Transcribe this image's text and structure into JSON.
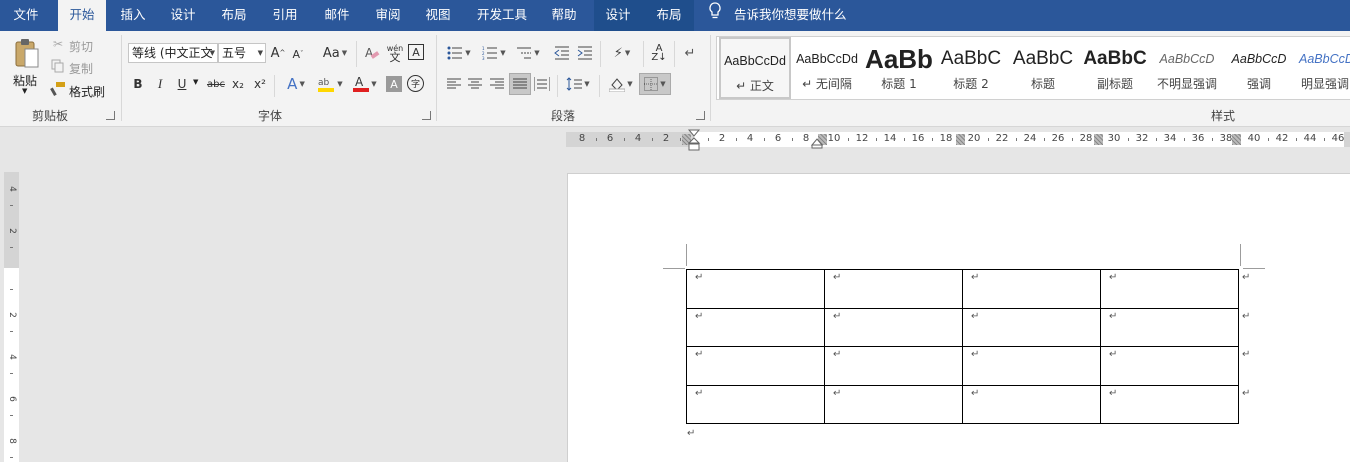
{
  "menu": {
    "tabs": [
      "文件",
      "开始",
      "插入",
      "设计",
      "布局",
      "引用",
      "邮件",
      "审阅",
      "视图",
      "开发工具",
      "帮助",
      "设计",
      "布局"
    ],
    "active_index": 1,
    "tell_me": "告诉我你想要做什么"
  },
  "clipboard": {
    "paste": "粘贴",
    "cut": "剪切",
    "copy": "复制",
    "format_painter": "格式刷",
    "group_label": "剪贴板"
  },
  "font": {
    "name": "等线 (中文正文",
    "size": "五号",
    "change_case": "Aa",
    "pinyin": "wén\n文",
    "bold": "B",
    "italic": "I",
    "underline": "U",
    "strike": "abc",
    "subscript": "x₂",
    "superscript": "x²",
    "char_border": "A",
    "enclose": "字",
    "group_label": "字体"
  },
  "paragraph": {
    "group_label": "段落"
  },
  "styles": {
    "group_label": "样式",
    "items": [
      {
        "preview": "AaBbCcDd",
        "name": "↵ 正文"
      },
      {
        "preview": "AaBbCcDd",
        "name": "↵ 无间隔"
      },
      {
        "preview": "AaBb",
        "name": "标题 1"
      },
      {
        "preview": "AaBbC",
        "name": "标题 2"
      },
      {
        "preview": "AaBbC",
        "name": "标题"
      },
      {
        "preview": "AaBbC",
        "name": "副标题"
      },
      {
        "preview": "AaBbCcD",
        "name": "不明显强调"
      },
      {
        "preview": "AaBbCcD",
        "name": "强调"
      },
      {
        "preview": "AaBbCcD",
        "name": "明显强调"
      }
    ]
  },
  "ruler": {
    "h_numbers": [
      "8",
      "6",
      "4",
      "2",
      "",
      "2",
      "4",
      "6",
      "8",
      "10",
      "12",
      "14",
      "16",
      "18",
      "20",
      "22",
      "24",
      "26",
      "28",
      "30",
      "32",
      "34",
      "36",
      "38",
      "40",
      "42",
      "44",
      "46"
    ],
    "v_numbers": [
      "4",
      "2",
      "",
      "2",
      "4",
      "6",
      "8"
    ]
  },
  "document": {
    "table": {
      "rows": 4,
      "cols": 4,
      "cell_mark": "↵"
    },
    "paragraph_mark": "↵"
  },
  "colors": {
    "brand": "#2b579a",
    "font_color": "#e02020",
    "highlight": "#ffd700"
  }
}
